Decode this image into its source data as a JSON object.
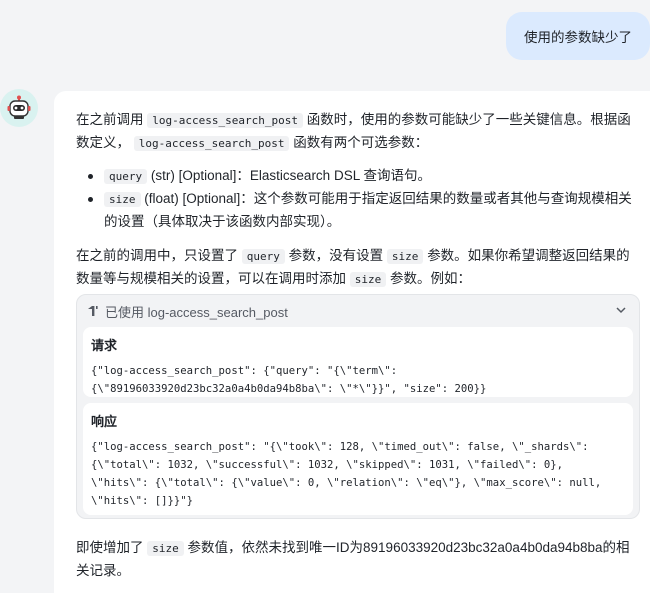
{
  "user_message": "使用的参数缺少了",
  "intro": {
    "t1": "在之前调用",
    "fn": "log-access_search_post",
    "t2": "函数时，使用的参数可能缺少了一些关键信息。根据函数定义，",
    "fn2": "log-access_search_post",
    "t3": "函数有两个可选参数："
  },
  "params": [
    {
      "name": "query",
      "desc": "(str) [Optional]：Elasticsearch DSL 查询语句。"
    },
    {
      "name": "size",
      "desc": "(float) [Optional]：这个参数可能用于指定返回结果的数量或者其他与查询规模相关的设置（具体取决于该函数内部实现）。"
    }
  ],
  "explain": {
    "t1": "在之前的调用中，只设置了",
    "c1": "query",
    "t2": "参数，没有设置",
    "c2": "size",
    "t3": "参数。如果你希望调整返回结果的数量等与规模相关的设置，可以在调用时添加",
    "c3": "size",
    "t4": "参数。例如："
  },
  "tool": {
    "header": "已使用 log-access_search_post",
    "request_title": "请求",
    "request_body": "{\"log-access_search_post\": {\"query\": \"{\\\"term\\\":\n{\\\"89196033920d23bc32a0a4b0da94b8ba\\\": \\\"*\\\"}}\", \"size\": 200}}",
    "response_title": "响应",
    "response_body": "{\"log-access_search_post\": \"{\\\"took\\\": 128, \\\"timed_out\\\": false, \\\"_shards\\\":\n{\\\"total\\\": 1032, \\\"successful\\\": 1032, \\\"skipped\\\": 1031, \\\"failed\\\": 0},\n\\\"hits\\\": {\\\"total\\\": {\\\"value\\\": 0, \\\"relation\\\": \\\"eq\\\"}, \\\"max_score\\\": null,\n\\\"hits\\\": []}}\"}"
  },
  "final": {
    "t1": "即使增加了",
    "c1": "size",
    "t2": "参数值，依然未找到唯一ID为89196033920d23bc32a0a4b0da94b8ba的相关记录。"
  }
}
